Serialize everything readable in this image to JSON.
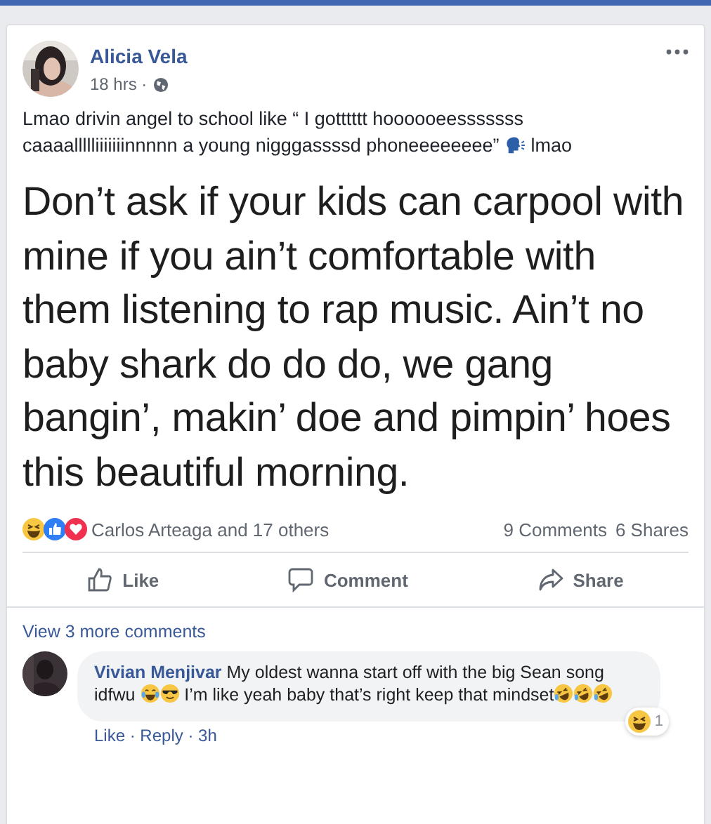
{
  "post": {
    "author": "Alicia Vela",
    "time": "18 hrs ·",
    "caption_before": "Lmao drivin angel to school like “ I gotttttt hoooooeesssssss caaaallllliiiiiiinnnnn a young nigggassssd phoneeeeeeee”",
    "caption_after": "lmao",
    "image_text": "Don’t ask if your kids can carpool with mine if you ain’t comfortable with them listening to rap music. Ain’t no baby shark do do do, we gang bangin’, makin’ doe and pimpin’ hoes this beautiful morning.",
    "reactions_text": "Carlos Arteaga and 17 others",
    "comments_count": "9 Comments",
    "shares_count": "6 Shares",
    "actions": [
      {
        "kind": "like",
        "label": "Like"
      },
      {
        "kind": "comment",
        "label": "Comment"
      },
      {
        "kind": "share",
        "label": "Share"
      }
    ]
  },
  "comments": {
    "view_more": "View 3 more comments",
    "items": [
      {
        "author": "Vivian Menjivar",
        "text_parts": [
          "My oldest wanna start off with the big Sean song idfwu",
          "I’m like yeah baby that’s right keep that mindset"
        ],
        "reaction_count": "1",
        "footer": "Like · Reply · 3h"
      }
    ]
  }
}
